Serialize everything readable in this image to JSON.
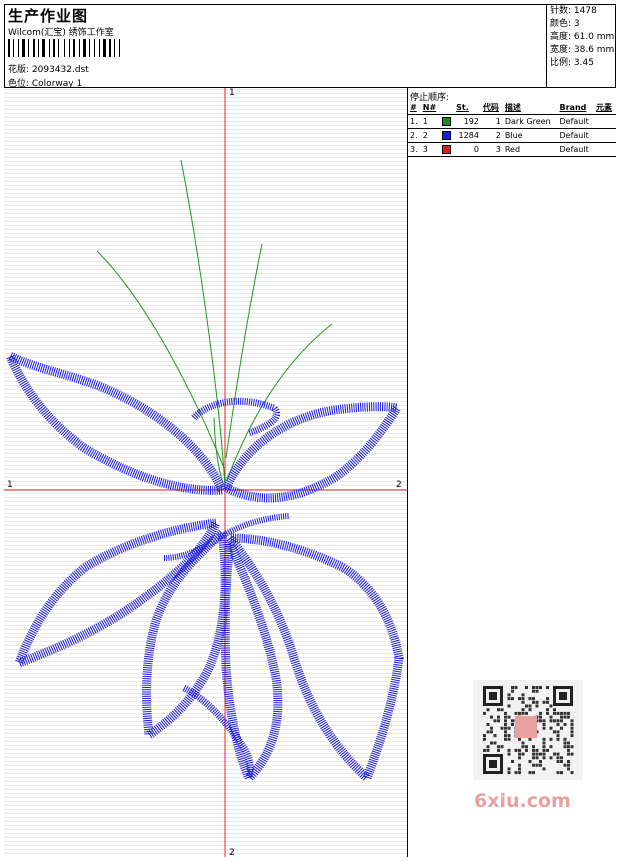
{
  "header": {
    "title": "生产作业图",
    "subtitle": "Wilcom(汇宝) 绣饰工作室",
    "design_file": "花版: 2093432.dst",
    "colorway": "色位: Colorway 1"
  },
  "stats": {
    "stitches": "针数: 1478",
    "colors": "颜色: 3",
    "height": "高度: 61.0 mm",
    "width": "宽度: 38.6 mm",
    "scale": "比例: 3.45"
  },
  "axes": {
    "v_top": "1",
    "v_bottom": "2",
    "h_left": "1",
    "h_right": "2"
  },
  "stop_sequence": {
    "heading": "停止顺序:",
    "columns": [
      "#",
      "N#",
      "St.",
      "代码",
      "描述",
      "Brand",
      "元素"
    ],
    "rows": [
      {
        "idx": "1.",
        "n": "1",
        "swatch": "#1a8a1a",
        "st": "192",
        "code": "1",
        "desc": "Dark Green",
        "brand": "Default"
      },
      {
        "idx": "2.",
        "n": "2",
        "swatch": "#1a1ae6",
        "st": "1284",
        "code": "2",
        "desc": "Blue",
        "brand": "Default"
      },
      {
        "idx": "3.",
        "n": "3",
        "swatch": "#e61a1a",
        "st": "0",
        "code": "3",
        "desc": "Red",
        "brand": "Default"
      }
    ]
  },
  "watermark": "6xiu.com",
  "colors": {
    "stitch_blue": "#1a1ae6",
    "stem_green": "#1a9a1a",
    "axis_red": "#e62020"
  }
}
